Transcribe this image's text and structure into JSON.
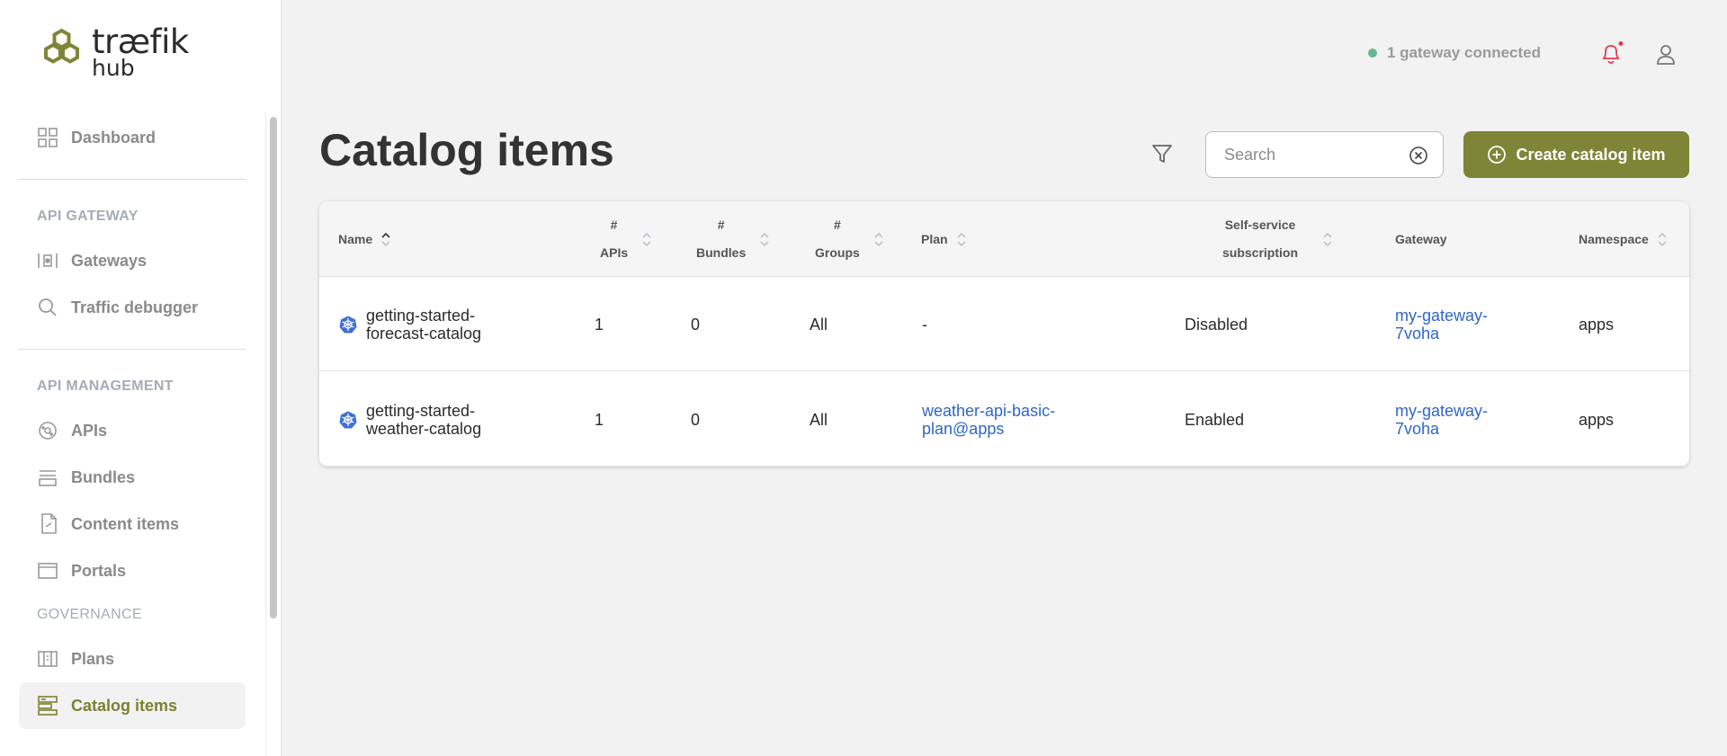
{
  "brand": {
    "word": "træfik",
    "sub": "hub"
  },
  "sidebar": {
    "items": [
      {
        "label": "Dashboard",
        "icon": "dashboard-icon"
      }
    ],
    "sections": [
      {
        "title": "API GATEWAY",
        "items": [
          {
            "label": "Gateways",
            "icon": "gateway-icon"
          },
          {
            "label": "Traffic debugger",
            "icon": "search-icon"
          }
        ]
      },
      {
        "title": "API MANAGEMENT",
        "items": [
          {
            "label": "APIs",
            "icon": "api-icon"
          },
          {
            "label": "Bundles",
            "icon": "bundle-icon"
          },
          {
            "label": "Content items",
            "icon": "document-icon"
          },
          {
            "label": "Portals",
            "icon": "portal-icon"
          }
        ]
      },
      {
        "title": "GOVERNANCE",
        "items": [
          {
            "label": "Plans",
            "icon": "plan-icon"
          },
          {
            "label": "Catalog items",
            "icon": "catalog-icon",
            "active": true
          }
        ]
      }
    ]
  },
  "topbar": {
    "status": "1 gateway connected",
    "status_color": "#67b891",
    "notification_color": "#e23b4f"
  },
  "page": {
    "title": "Catalog items"
  },
  "search": {
    "placeholder": "Search",
    "value": ""
  },
  "create_button": {
    "label": "Create catalog item",
    "color": "#7f8537"
  },
  "table": {
    "columns": {
      "name": "Name",
      "apis": [
        "#",
        "APIs"
      ],
      "bundles": [
        "#",
        "Bundles"
      ],
      "groups": [
        "#",
        "Groups"
      ],
      "plan": "Plan",
      "selfservice": [
        "Self-service",
        "subscription"
      ],
      "gateway": "Gateway",
      "namespace": "Namespace"
    },
    "rows": [
      {
        "name": [
          "getting-started-",
          "forecast-catalog"
        ],
        "apis": "1",
        "bundles": "0",
        "groups": "All",
        "plan": [
          "-"
        ],
        "plan_link": false,
        "selfservice": "Disabled",
        "gateway": [
          "my-gateway-",
          "7voha"
        ],
        "namespace": "apps"
      },
      {
        "name": [
          "getting-started-",
          "weather-catalog"
        ],
        "apis": "1",
        "bundles": "0",
        "groups": "All",
        "plan": [
          "weather-api-basic-",
          "plan@apps"
        ],
        "plan_link": true,
        "selfservice": "Enabled",
        "gateway": [
          "my-gateway-",
          "7voha"
        ],
        "namespace": "apps"
      }
    ]
  }
}
